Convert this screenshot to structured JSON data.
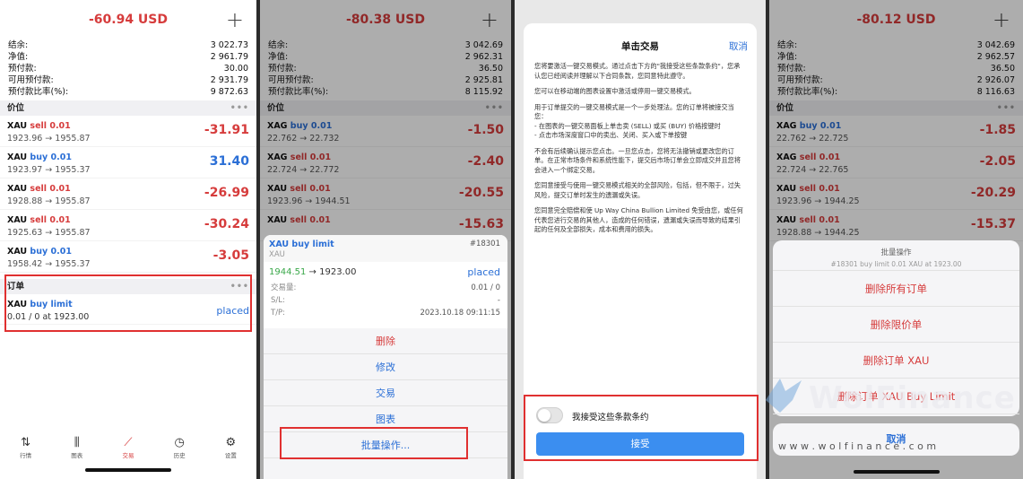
{
  "panel1": {
    "balance": "-60.94 USD",
    "plus": "+",
    "summary": [
      {
        "k": "结余:",
        "v": "3 022.73"
      },
      {
        "k": "净值:",
        "v": "2 961.79"
      },
      {
        "k": "预付款:",
        "v": "30.00"
      },
      {
        "k": "可用预付款:",
        "v": "2 931.79"
      },
      {
        "k": "预付款比率(%):",
        "v": "9 872.63"
      }
    ],
    "positions_header": "价位",
    "dots": "•••",
    "positions": [
      {
        "sym": "XAU",
        "side": "sell 0.01",
        "prices": "1923.96 → 1955.87",
        "pl": "-31.91",
        "type": "sell"
      },
      {
        "sym": "XAU",
        "side": "buy 0.01",
        "prices": "1923.97 → 1955.37",
        "pl": "31.40",
        "type": "buy"
      },
      {
        "sym": "XAU",
        "side": "sell 0.01",
        "prices": "1928.88 → 1955.87",
        "pl": "-26.99",
        "type": "sell"
      },
      {
        "sym": "XAU",
        "side": "sell 0.01",
        "prices": "1925.63 → 1955.87",
        "pl": "-30.24",
        "type": "sell"
      },
      {
        "sym": "XAU",
        "side": "buy 0.01",
        "prices": "1958.42 → 1955.37",
        "pl": "-3.05",
        "type": "buy"
      }
    ],
    "orders_header": "订单",
    "order": {
      "sym": "XAU",
      "side": "buy limit",
      "detail": "0.01 / 0 at 1923.00",
      "status": "placed"
    },
    "tabs": [
      {
        "label": "行情",
        "icon": "⇅"
      },
      {
        "label": "图表",
        "icon": "⫼"
      },
      {
        "label": "交易",
        "icon": "⟋"
      },
      {
        "label": "历史",
        "icon": "◷"
      },
      {
        "label": "设置",
        "icon": "⚙"
      }
    ]
  },
  "panel2": {
    "balance": "-80.38 USD",
    "plus": "+",
    "summary": [
      {
        "k": "结余:",
        "v": "3 042.69"
      },
      {
        "k": "净值:",
        "v": "2 962.31"
      },
      {
        "k": "预付款:",
        "v": "36.50"
      },
      {
        "k": "可用预付款:",
        "v": "2 925.81"
      },
      {
        "k": "预付款比率(%):",
        "v": "8 115.92"
      }
    ],
    "positions_header": "价位",
    "dots": "•••",
    "positions": [
      {
        "sym": "XAG",
        "side": "buy 0.01",
        "prices": "22.762 → 22.732",
        "pl": "-1.50",
        "type": "buy"
      },
      {
        "sym": "XAG",
        "side": "sell 0.01",
        "prices": "22.724 → 22.772",
        "pl": "-2.40",
        "type": "sell"
      },
      {
        "sym": "XAU",
        "side": "sell 0.01",
        "prices": "1923.96 → 1944.51",
        "pl": "-20.55",
        "type": "sell"
      },
      {
        "sym": "XAU",
        "side": "sell 0.01",
        "prices": "",
        "pl": "-15.63",
        "type": "sell"
      }
    ],
    "card": {
      "title": "XAU buy limit",
      "id": "#18301",
      "sub": "XAU",
      "prices_a": "1944.51",
      "prices_b": "→ 1923.00",
      "status": "placed",
      "rows": [
        {
          "k": "交易量:",
          "v": "0.01 / 0"
        },
        {
          "k": "S/L:",
          "v": "-"
        },
        {
          "k": "T/P:",
          "v": "2023.10.18 09:11:15"
        }
      ]
    },
    "menu": [
      "删除",
      "修改",
      "交易",
      "图表",
      "批量操作..."
    ]
  },
  "panel3": {
    "title": "单击交易",
    "cancel": "取消",
    "paragraphs": [
      "您将要激活一键交易模式。通过点击下方的\"我接受这些条款条约\"，您承认您已经阅读并理解以下合同条款，您同意特此遵守。",
      "您可以在移动端的图表设置中激活或停用一键交易模式。",
      "用于订单提交的一键交易模式是一个一步处理法。您的订单将被接交当您：\n- 在图表的一键交易面板上单击卖 (SELL) 或买 (BUY) 价格按键时\n- 点击市场深度窗口中的卖出、关闭、买入或下单按键",
      "不会有后续确认提示您点击。一旦您点击，您将无法撤销或更改您的订单。在正常市场条件和系统性能下，提交后市场订单会立即成交并且您将会进入一个绑定交易。",
      "您同意接受与使用一键交易模式相关的全部风险，包括，但不限于，过失风险，提交订单时发生的遗漏或失误。",
      "您同意完全赔偿和使 Up Way China Bullion Limited 免受由您，或任何代表您进行交易的其他人，造成的任何错误，遗漏或失误而导致的结果引起的任何及全部损失，成本和费用的损失。"
    ],
    "accept_label": "我接受这些条款条约",
    "accept_button": "接受"
  },
  "panel4": {
    "balance": "-80.12 USD",
    "plus": "+",
    "summary": [
      {
        "k": "结余:",
        "v": "3 042.69"
      },
      {
        "k": "净值:",
        "v": "2 962.57"
      },
      {
        "k": "预付款:",
        "v": "36.50"
      },
      {
        "k": "可用预付款:",
        "v": "2 926.07"
      },
      {
        "k": "预付款比率(%):",
        "v": "8 116.63"
      }
    ],
    "positions_header": "价位",
    "dots": "•••",
    "positions": [
      {
        "sym": "XAG",
        "side": "buy 0.01",
        "prices": "22.762 → 22.725",
        "pl": "-1.85",
        "type": "buy"
      },
      {
        "sym": "XAG",
        "side": "sell 0.01",
        "prices": "22.724 → 22.765",
        "pl": "-2.05",
        "type": "sell"
      },
      {
        "sym": "XAU",
        "side": "sell 0.01",
        "prices": "1923.96 → 1944.25",
        "pl": "-20.29",
        "type": "sell"
      },
      {
        "sym": "XAU",
        "side": "sell 0.01",
        "prices": "1928.88 → 1944.25",
        "pl": "-15.37",
        "type": "sell"
      }
    ],
    "sheet_title": "批量操作",
    "sheet_sub": "#18301 buy limit 0.01 XAU at 1923.00",
    "actions": [
      "删除所有订单",
      "删除限价单",
      "删除订单 XAU",
      "删除订单 XAU Buy Limit"
    ],
    "cancel": "取消"
  },
  "watermark": {
    "brand": "WolFinance",
    "url": "w w w . w o l f i n a n c e . c o m"
  }
}
